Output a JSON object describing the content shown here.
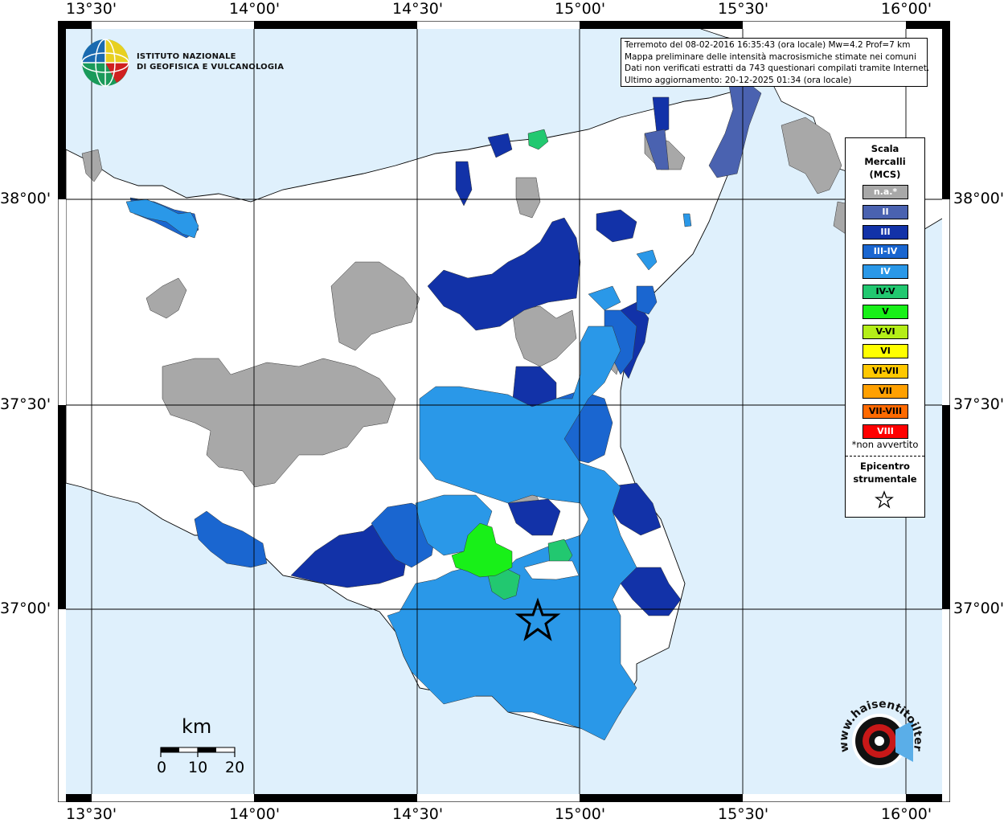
{
  "header": {
    "info_lines": [
      "Terremoto del 08-02-2016 16:35:43 (ora locale) Mw=4.2 Prof=7 km",
      "Mappa preliminare delle intensità macrosismiche stimate nei comuni",
      "Dati non verificati estratti da 743 questionari compilati tramite Internet.",
      "Ultimo aggiornamento: 20-12-2025 01:34 (ora locale)"
    ]
  },
  "logos": {
    "ingv_line1": "ISTITUTO NAZIONALE",
    "ingv_line2": "DI GEOFISICA E VULCANOLOGIA",
    "hst_text": "www.haisentitoilterremoto.it"
  },
  "axes": {
    "top_longitudes": [
      "13°30'",
      "14°00'",
      "14°30'",
      "15°00'",
      "15°30'",
      "16°00'"
    ],
    "bottom_longitudes": [
      "13°30'",
      "14°00'",
      "14°30'",
      "15°00'",
      "15°30'",
      "16°00'"
    ],
    "left_latitudes": [
      "38°00'",
      "37°30'",
      "37°00'"
    ],
    "right_latitudes": [
      "38°00'",
      "37°30'",
      "37°00'"
    ]
  },
  "legend": {
    "title_line1": "Scala",
    "title_line2": "Mercalli",
    "title_line3": "(MCS)",
    "items": [
      {
        "label": "n.a.*",
        "color": "#a8a8a8",
        "text_color": "#ffffff"
      },
      {
        "label": "II",
        "color": "#4a62b0",
        "text_color": "#ffffff"
      },
      {
        "label": "III",
        "color": "#1232a8",
        "text_color": "#ffffff"
      },
      {
        "label": "III-IV",
        "color": "#1a66d0",
        "text_color": "#ffffff"
      },
      {
        "label": "IV",
        "color": "#2a98e8",
        "text_color": "#ffffff"
      },
      {
        "label": "IV-V",
        "color": "#22c870",
        "text_color": "#000000"
      },
      {
        "label": "V",
        "color": "#18f018",
        "text_color": "#000000"
      },
      {
        "label": "V-VI",
        "color": "#b4ee18",
        "text_color": "#000000"
      },
      {
        "label": "VI",
        "color": "#ffff00",
        "text_color": "#000000"
      },
      {
        "label": "VI-VII",
        "color": "#ffc800",
        "text_color": "#000000"
      },
      {
        "label": "VII",
        "color": "#ffa000",
        "text_color": "#000000"
      },
      {
        "label": "VII-VIII",
        "color": "#ff6a00",
        "text_color": "#000000"
      },
      {
        "label": "VIII",
        "color": "#ff0000",
        "text_color": "#ffffff"
      }
    ],
    "note": "*non avvertito",
    "epicenter_line1": "Epicentro",
    "epicenter_line2": "strumentale"
  },
  "scale": {
    "unit": "km",
    "ticks": [
      "0",
      "10",
      "20"
    ]
  },
  "colors": {
    "sea": "#dff0fc",
    "land": "#ffffff",
    "not_available": "#a8a8a8",
    "grid": "#000000"
  }
}
